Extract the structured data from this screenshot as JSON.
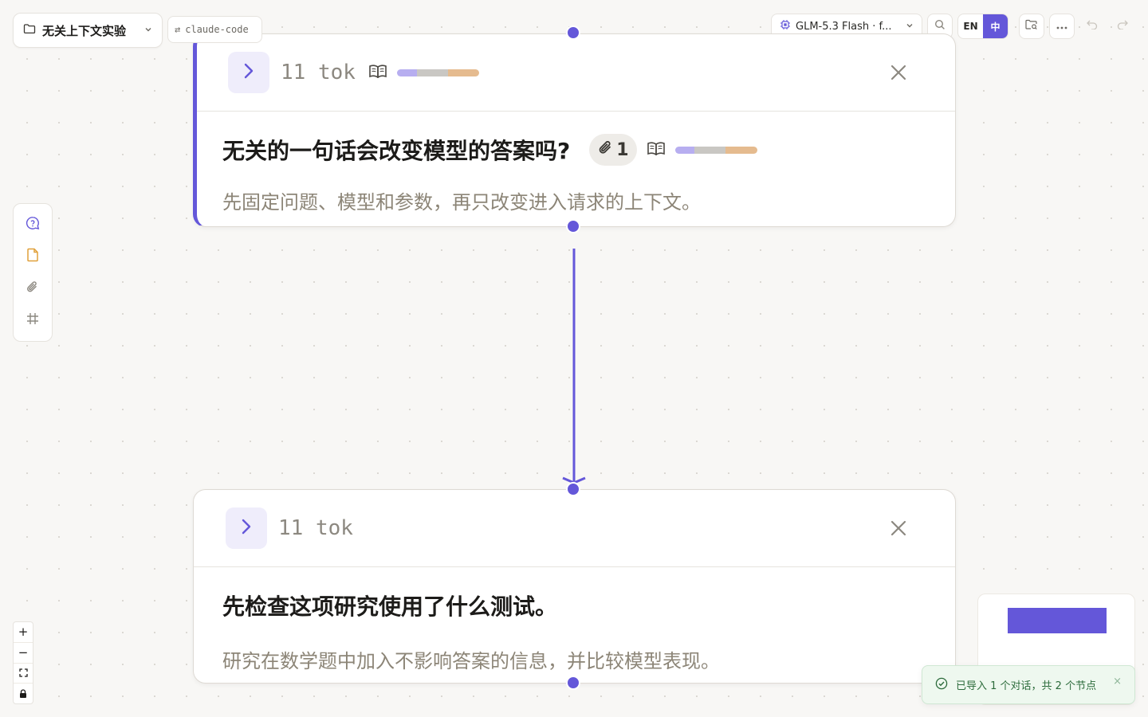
{
  "project": {
    "name": "无关上下文实验",
    "icon": "folder-icon",
    "chevron": "chevron-down-icon"
  },
  "source": {
    "icon_text": "⇄",
    "label": "claude-code"
  },
  "toolbar": {
    "model_name": "GLM-5.3 Flash · f...",
    "model_icon": "chip-icon",
    "lang_en": "EN",
    "lang_zh": "中",
    "lang_active": "zh"
  },
  "colors": {
    "accent": "#6457d9",
    "ctx_system": "#b7aef0",
    "ctx_history": "#c9c7c3",
    "ctx_prompt": "#e5bb8f",
    "toast_bg": "#eef8ef",
    "toast_text": "#2c6b3b"
  },
  "nodes": [
    {
      "tokens": "11 tok",
      "question": "无关的一句话会改变模型的答案吗?",
      "attachment_count": "1",
      "answer": "先固定问题、模型和参数，再只改变进入请求的上下文。",
      "selected": true,
      "context_breakdown": [
        0.24,
        0.38,
        0.38
      ]
    },
    {
      "tokens": "11 tok",
      "question": "先检查这项研究使用了什么测试。",
      "answer": "研究在数学题中加入不影响答案的信息，并比较模型表现。",
      "selected": false
    }
  ],
  "zoom_controls": {
    "zoom_in": "+",
    "zoom_out": "−"
  },
  "toast": {
    "message": "已导入 1 个对话，共 2 个节点",
    "close": "×"
  }
}
